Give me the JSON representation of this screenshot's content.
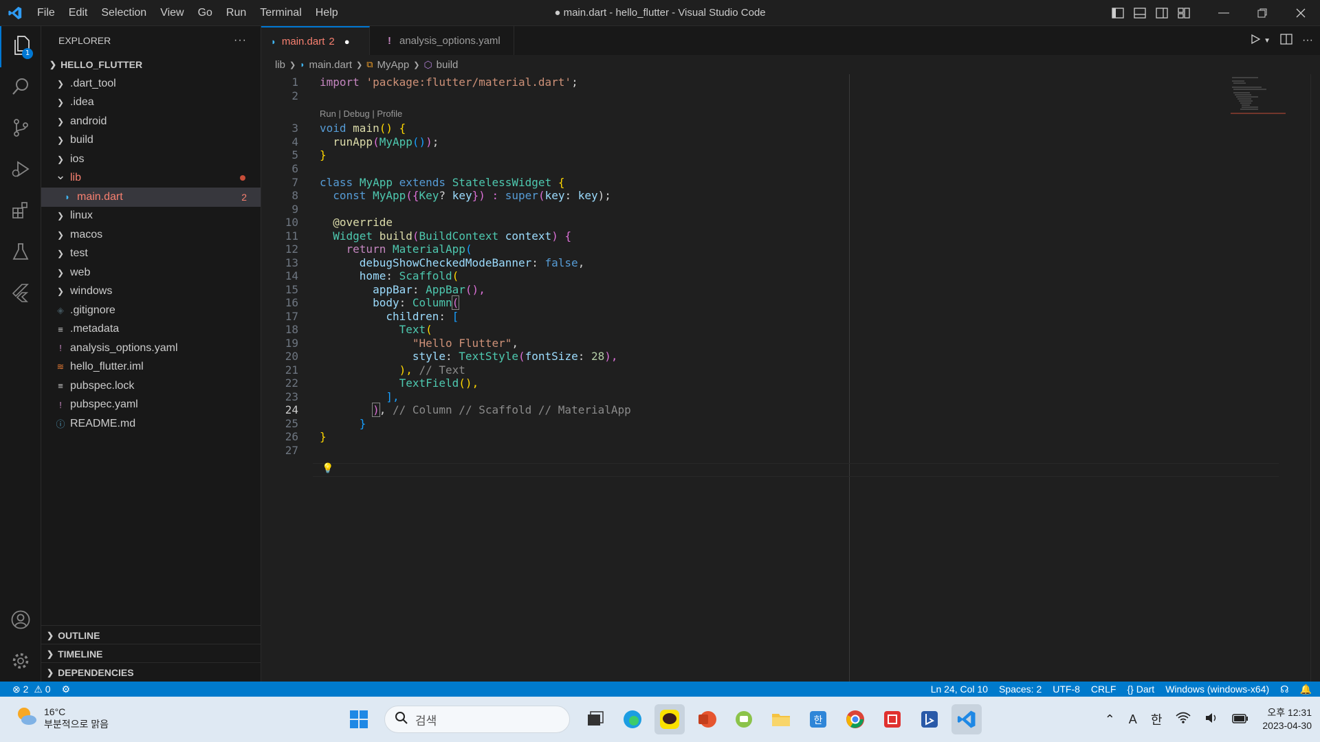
{
  "window": {
    "title": "● main.dart - hello_flutter - Visual Studio Code",
    "menu": [
      "File",
      "Edit",
      "Selection",
      "View",
      "Go",
      "Run",
      "Terminal",
      "Help"
    ]
  },
  "activity": {
    "explorer_badge": "1"
  },
  "explorer": {
    "header": "EXPLORER",
    "more": "···",
    "root": "HELLO_FLUTTER",
    "items": [
      {
        "label": ".dart_tool",
        "kind": "folder"
      },
      {
        "label": ".idea",
        "kind": "folder"
      },
      {
        "label": "android",
        "kind": "folder"
      },
      {
        "label": "build",
        "kind": "folder"
      },
      {
        "label": "ios",
        "kind": "folder"
      },
      {
        "label": "lib",
        "kind": "folder-open"
      },
      {
        "label": "main.dart",
        "kind": "dart",
        "count": "2"
      },
      {
        "label": "linux",
        "kind": "folder"
      },
      {
        "label": "macos",
        "kind": "folder"
      },
      {
        "label": "test",
        "kind": "folder"
      },
      {
        "label": "web",
        "kind": "folder"
      },
      {
        "label": "windows",
        "kind": "folder"
      },
      {
        "label": ".gitignore",
        "kind": "git"
      },
      {
        "label": ".metadata",
        "kind": "text"
      },
      {
        "label": "analysis_options.yaml",
        "kind": "yaml"
      },
      {
        "label": "hello_flutter.iml",
        "kind": "rss"
      },
      {
        "label": "pubspec.lock",
        "kind": "text"
      },
      {
        "label": "pubspec.yaml",
        "kind": "yaml"
      },
      {
        "label": "README.md",
        "kind": "info"
      }
    ],
    "sections": [
      "OUTLINE",
      "TIMELINE",
      "DEPENDENCIES"
    ]
  },
  "tabs": [
    {
      "label": "main.dart",
      "badge": "2",
      "modified": "●"
    },
    {
      "label": "analysis_options.yaml"
    }
  ],
  "breadcrumb": [
    "lib",
    "main.dart",
    "MyApp",
    "build"
  ],
  "codelens": "Run | Debug | Profile",
  "line_numbers": [
    "1",
    "2",
    "3",
    "4",
    "5",
    "6",
    "7",
    "8",
    "9",
    "10",
    "11",
    "12",
    "13",
    "14",
    "15",
    "16",
    "17",
    "18",
    "19",
    "20",
    "21",
    "22",
    "23",
    "24",
    "25",
    "26",
    "27"
  ],
  "current_line": "24",
  "code": {
    "l1_kw": "import",
    "l1_str": "'package:flutter/material.dart'",
    "l1_end": ";",
    "l3_kw": "void",
    "l3_fn": "main",
    "l3_rest": "() {",
    "l4_fn": "runApp",
    "l4_cls": "MyApp",
    "l4_rest": "());",
    "l5": "}",
    "l7_kw": "class",
    "l7_cls": "MyApp",
    "l7_ext": "extends",
    "l7_cls2": "StatelessWidget",
    "l7_b": "{",
    "l8_kw": "const",
    "l8_cls": "MyApp",
    "l8_p1": "({",
    "l8_cls2": "Key",
    "l8_q": "? ",
    "l8_var": "key",
    "l8_p2": "}) : ",
    "l8_super": "super",
    "l8_p3": "(",
    "l8_var2": "key",
    "l8_colon": ": ",
    "l8_var3": "key",
    "l8_end": ");",
    "l10": "@override",
    "l11_cls": "Widget",
    "l11_fn": "build",
    "l11_p": "(",
    "l11_cls2": "BuildContext",
    "l11_var": "context",
    "l11_end": ") {",
    "l12_kw": "return",
    "l12_cls": "MaterialApp",
    "l12_p": "(",
    "l13_var": "debugShowCheckedModeBanner",
    "l13_c": ": ",
    "l13_kw": "false",
    "l13_end": ",",
    "l14_var": "home",
    "l14_c": ": ",
    "l14_cls": "Scaffold",
    "l14_p": "(",
    "l15_var": "appBar",
    "l15_c": ": ",
    "l15_cls": "AppBar",
    "l15_end": "(),",
    "l16_var": "body",
    "l16_c": ": ",
    "l16_cls": "Column",
    "l16_p": "(",
    "l17_var": "children",
    "l17_c": ": ",
    "l17_p": "[",
    "l18_cls": "Text",
    "l18_p": "(",
    "l19_str": "\"Hello Flutter\"",
    "l19_end": ",",
    "l20_var": "style",
    "l20_c": ": ",
    "l20_cls": "TextStyle",
    "l20_p": "(",
    "l20_var2": "fontSize",
    "l20_c2": ": ",
    "l20_num": "28",
    "l20_end": "),",
    "l21_p": "),",
    "l21_cm": " // Text",
    "l22_cls": "TextField",
    "l22_end": "(),",
    "l23": "],",
    "l24_p": ")",
    "l24_c": ",",
    "l24_cm": " // Column // Scaffold // MaterialApp",
    "l25": "}",
    "l26": "}"
  },
  "status": {
    "errors": "2",
    "warnings": "0",
    "position": "Ln 24, Col 10",
    "spaces": "Spaces: 2",
    "encoding": "UTF-8",
    "eol": "CRLF",
    "language": "Dart",
    "device": "Windows (windows-x64)"
  },
  "taskbar": {
    "temp": "16°C",
    "weather": "부분적으로 맑음",
    "search_placeholder": "검색",
    "tray_a": "A",
    "tray_lang": "한",
    "time": "오후 12:31",
    "date": "2023-04-30"
  },
  "colors": {
    "accent": "#0078d4",
    "statusbar": "#007acc",
    "error": "#f88070"
  }
}
